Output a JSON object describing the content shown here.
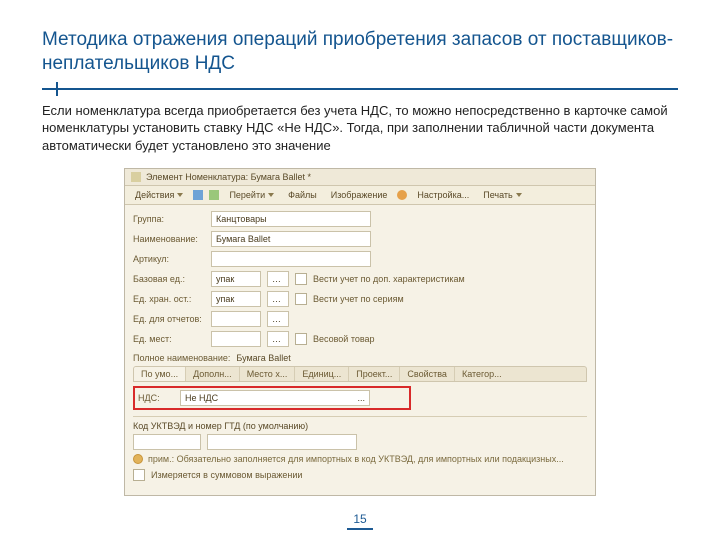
{
  "slide": {
    "title": "Методика отражения операций приобретения запасов от поставщиков-неплательщиков НДС",
    "paragraph": "Если номенклатура всегда приобретается без учета НДС, то можно непосредственно в карточке самой номенклатуры установить ставку НДС «Не НДС». Тогда, при заполнении табличной части документа автоматически будет установлено это значение",
    "page_number": "15"
  },
  "app": {
    "window_title": "Элемент Номенклатура: Бумага Ballet *",
    "toolbar": {
      "actions": "Действия",
      "goto": "Перейти",
      "files": "Файлы",
      "images": "Изображение",
      "settings": "Настройка...",
      "print": "Печать"
    },
    "fields": {
      "group_label": "Группа:",
      "group_value": "Канцтовары",
      "name_label": "Наименование:",
      "name_value": "Бумага Ballet",
      "article_label": "Артикул:",
      "base_unit_label": "Базовая ед.:",
      "base_unit_value": "упак",
      "keep_char_label": "Вести учет по доп. характеристикам",
      "store_unit_label": "Ед. хран. ост.:",
      "store_unit_value": "упак",
      "keep_series_label": "Вести учет по сериям",
      "place_unit_label": "Ед. для отчетов:",
      "weight_label": "Ед. мест:",
      "weight_good_label": "Весовой товар"
    },
    "fullname": {
      "label": "Полное наименование:",
      "value": "Бумага Ballet"
    },
    "tabs": {
      "t0": "По умо...",
      "t1": "Дополн...",
      "t2": "Место х...",
      "t3": "Единиц...",
      "t4": "Проект...",
      "t5": "Свойства",
      "t6": "Категор..."
    },
    "nds": {
      "label": "НДС:",
      "value": "Не НДС",
      "dots": "..."
    },
    "gtd": {
      "label": "Код УКТВЭД и номер ГТД (по умолчанию)",
      "hint": "прим.: Обязательно заполняется для импортных в код УКТВЭД, для импортных или подакцизных..."
    },
    "sync": {
      "label": "Измеряется в суммовом выражении"
    }
  }
}
